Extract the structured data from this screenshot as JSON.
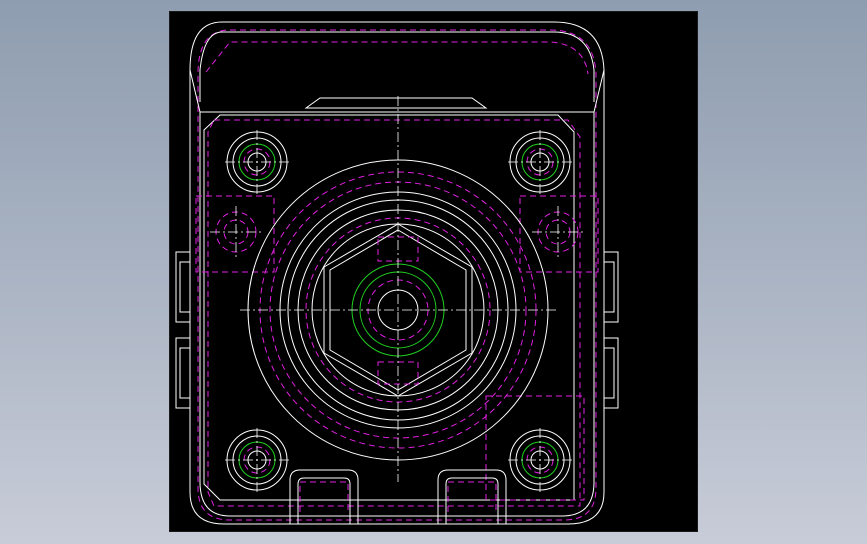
{
  "canvas": {
    "background": "#000000",
    "window_gradient_top": "#8e9db0",
    "window_gradient_bottom": "#c8ccd8"
  },
  "colors": {
    "outline": "#ffffff",
    "hidden_line": "#e020e0",
    "thread": "#20d020"
  },
  "drawing": {
    "view": "front-view",
    "part": "square-flange-cylinder-end-cap",
    "labels": []
  }
}
